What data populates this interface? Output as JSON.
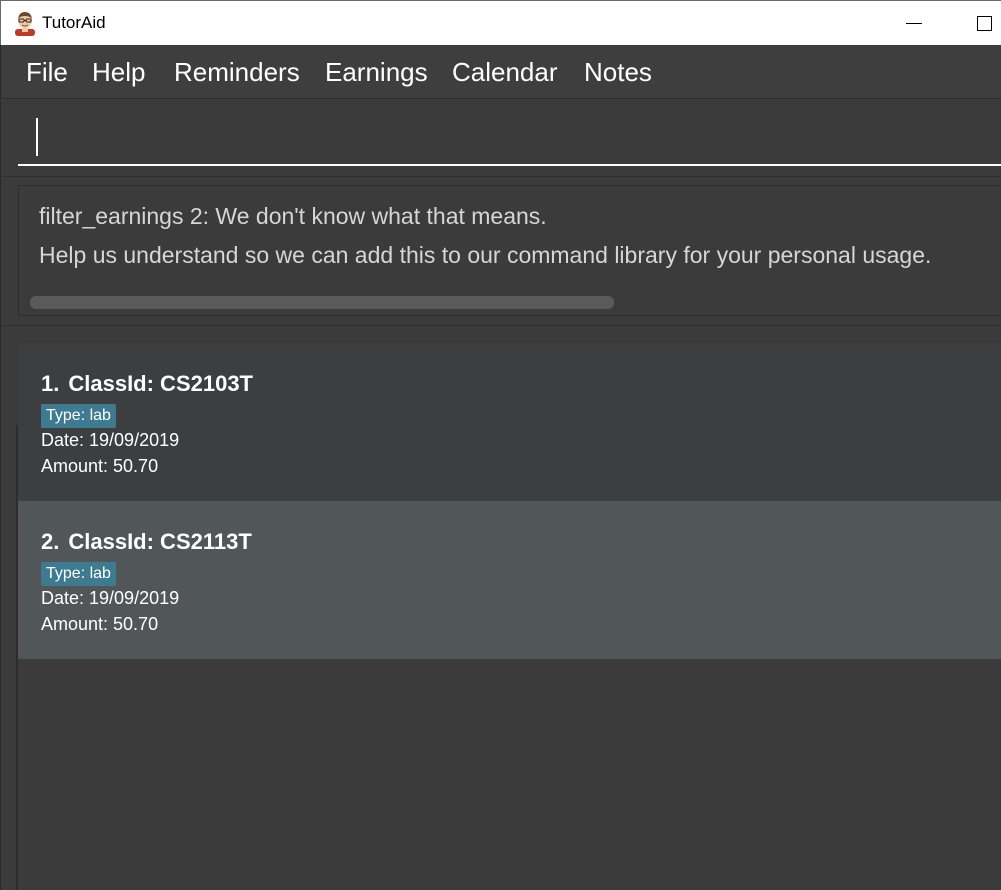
{
  "window": {
    "title": "TutorAid",
    "icon": "tutor-avatar-icon",
    "minimize_icon": "minimize-icon",
    "maximize_icon": "maximize-icon"
  },
  "menu": {
    "items": [
      {
        "label": "File"
      },
      {
        "label": "Help"
      },
      {
        "label": "Reminders"
      },
      {
        "label": "Earnings"
      },
      {
        "label": "Calendar"
      },
      {
        "label": "Notes"
      }
    ]
  },
  "command_box": {
    "value": "",
    "placeholder": ""
  },
  "result_display": {
    "line1": "filter_earnings 2: We don't know what that means.",
    "line2": "Help us understand so we can add this to our command library for your personal usage."
  },
  "earnings": [
    {
      "index": "1.",
      "class_id": "ClassId: CS2103T",
      "type": "Type: lab",
      "date": "Date: 19/09/2019",
      "amount": "Amount: 50.70"
    },
    {
      "index": "2.",
      "class_id": "ClassId: CS2113T",
      "type": "Type: lab",
      "date": "Date: 19/09/2019",
      "amount": "Amount: 50.70"
    }
  ],
  "colors": {
    "background": "#3b3b3b",
    "menubar": "#3e3e3e",
    "selected_card": "#515658",
    "tag": "#3e7b91"
  }
}
